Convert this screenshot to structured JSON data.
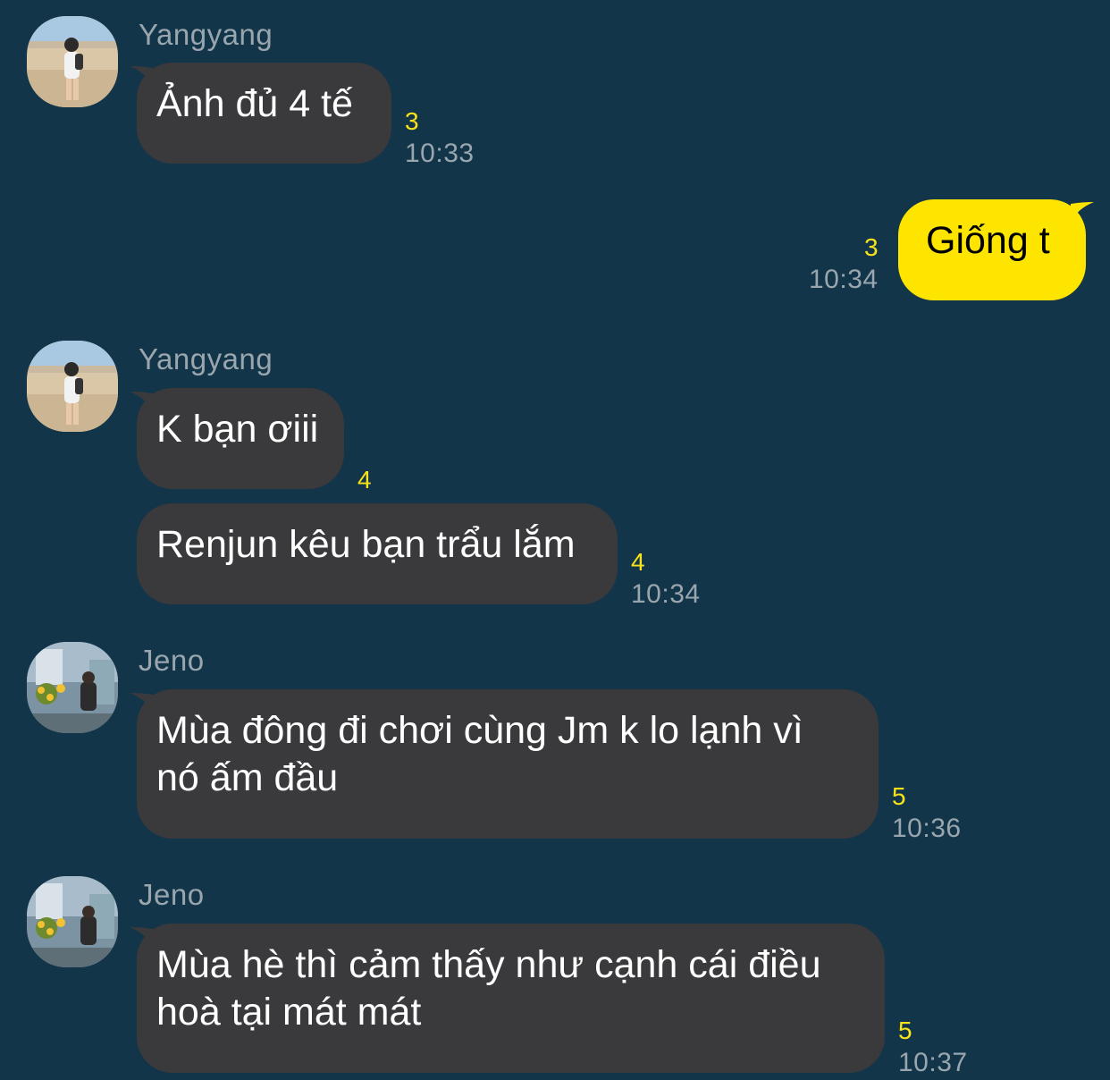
{
  "messages": [
    {
      "sender": "Yangyang",
      "text": "Ảnh đủ 4 tế",
      "unread": "3",
      "time": "10:33"
    },
    {
      "sender": "",
      "text": "Giống t",
      "unread": "3",
      "time": "10:34"
    },
    {
      "sender": "Yangyang",
      "text": "K bạn ơiii",
      "unread": "4",
      "time": ""
    },
    {
      "sender": "",
      "text": "Renjun kêu bạn trẩu lắm",
      "unread": "4",
      "time": "10:34"
    },
    {
      "sender": "Jeno",
      "text": "Mùa đông đi chơi cùng Jm k lo lạnh vì",
      "text2": "nó ấm đầu",
      "unread": "5",
      "time": "10:36"
    },
    {
      "sender": "Jeno",
      "text": "Mùa hè thì cảm thấy như cạnh cái điều",
      "text2": "hoà tại mát mát",
      "unread": "5",
      "time": "10:37"
    }
  ],
  "colors": {
    "background": "#123549",
    "incoming_bubble": "#3a393c",
    "outgoing_bubble": "#fee500",
    "unread_count": "#f8e31a",
    "meta_text": "#9aa6ae"
  },
  "icons": {
    "yangyang_avatar": "beach-photo-avatar",
    "jeno_avatar": "flower-shop-photo-avatar"
  }
}
